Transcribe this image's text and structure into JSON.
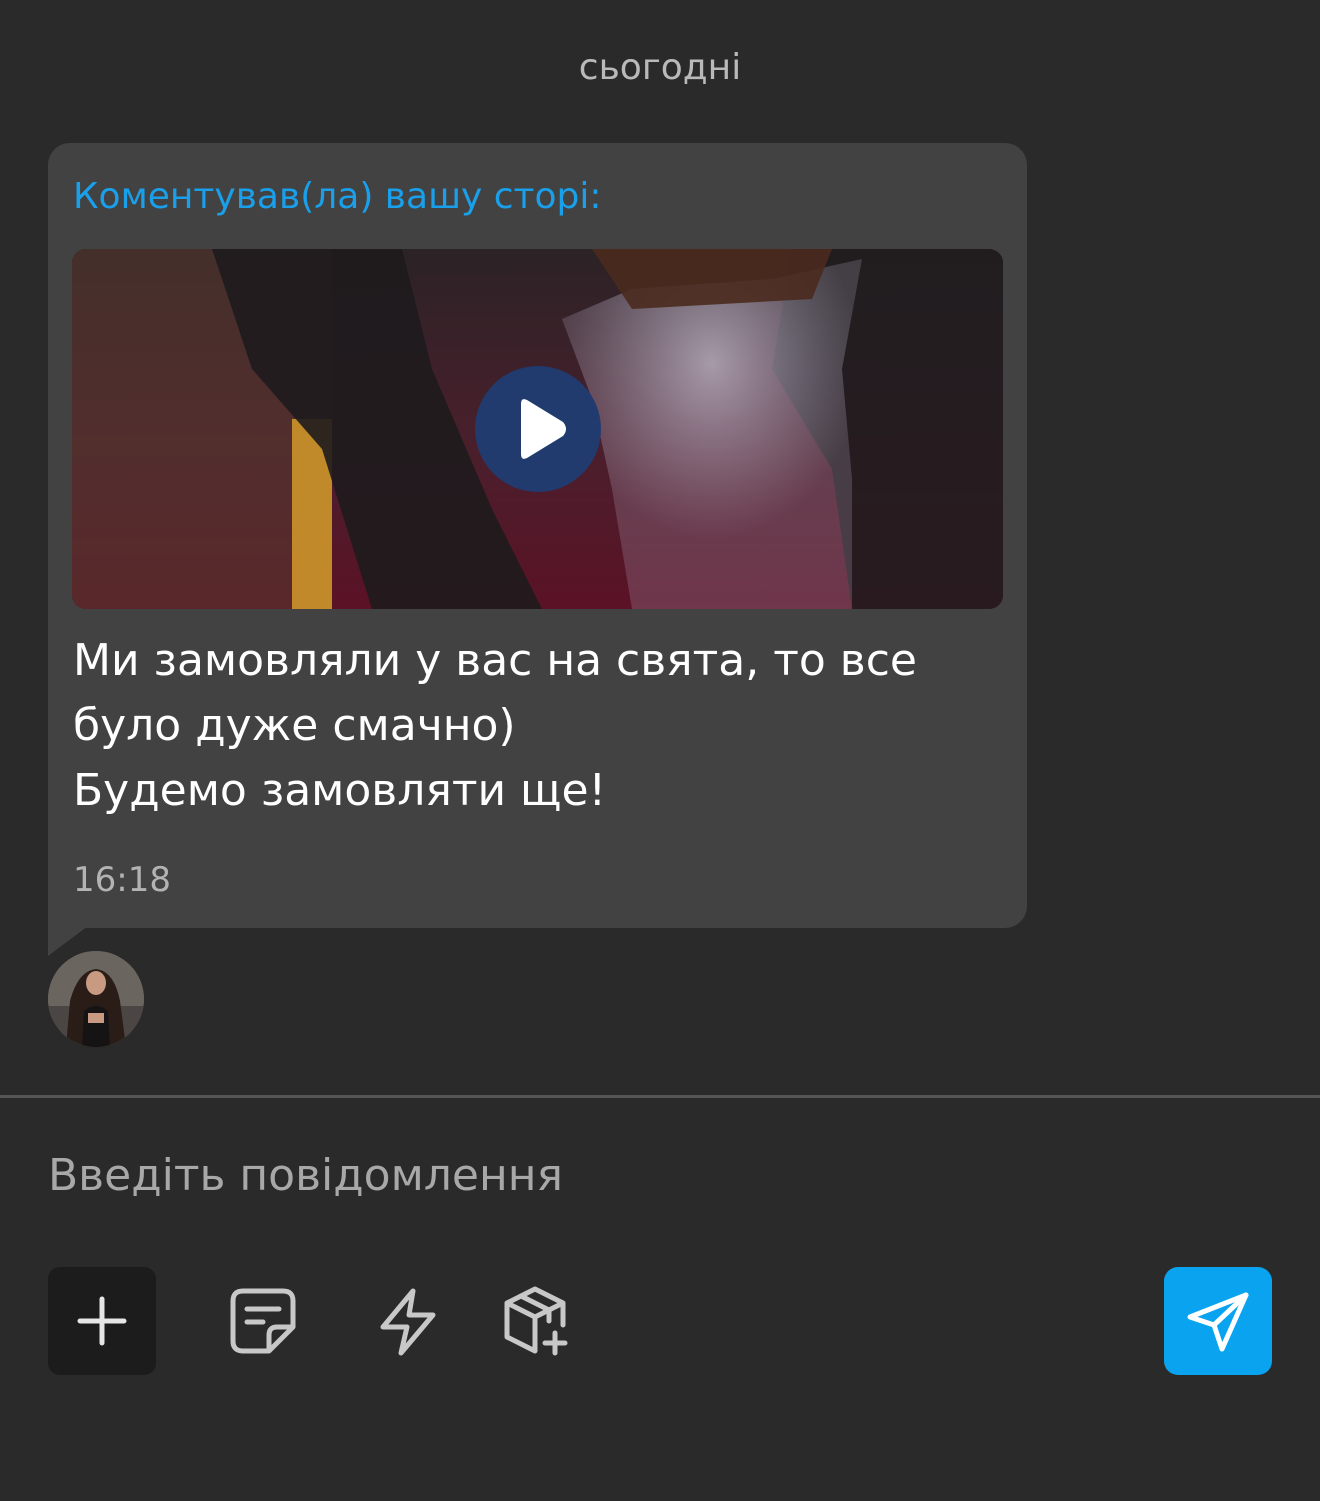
{
  "chat": {
    "date_separator": "сьогодні",
    "message": {
      "story_label": "Коментував(ла) вашу сторі:",
      "text_lines": [
        "Ми замовляли у вас на свята, то все",
        "було дуже смачно)",
        "Будемо замовляти ще!"
      ],
      "time": "16:18",
      "media_icon": "play-icon"
    },
    "sender": {
      "avatar_icon": "avatar-photo"
    }
  },
  "composer": {
    "placeholder": "Введіть повідомлення",
    "value": "",
    "tools": [
      {
        "icon": "plus-icon"
      },
      {
        "icon": "note-icon"
      },
      {
        "icon": "lightning-icon"
      },
      {
        "icon": "package-add-icon"
      }
    ],
    "send_icon": "send-icon"
  },
  "colors": {
    "background": "#2a2a2a",
    "bubble": "#424242",
    "accent_link": "#1a9fea",
    "send_button": "#0aa3f0",
    "play_button": "#213b6f"
  }
}
